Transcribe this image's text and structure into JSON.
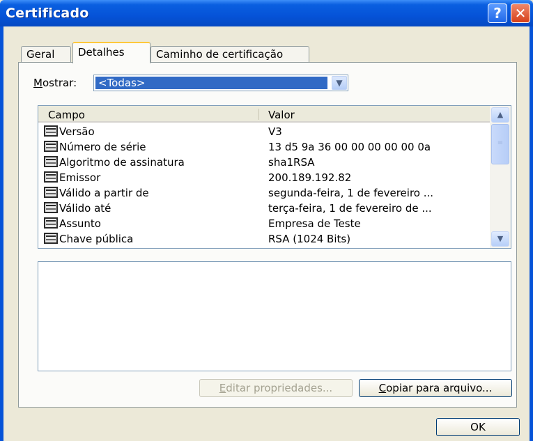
{
  "window": {
    "title": "Certificado",
    "help_glyph": "?",
    "close_glyph": "✕"
  },
  "tabs": [
    {
      "label": "Geral",
      "active": false
    },
    {
      "label": "Detalhes",
      "active": true
    },
    {
      "label": "Caminho de certificação",
      "active": false
    }
  ],
  "show": {
    "label": "Mostrar:",
    "label_underline_char": "M",
    "label_rest": "ostrar:",
    "selected": "<Todas>"
  },
  "list": {
    "headers": {
      "field": "Campo",
      "value": "Valor"
    },
    "rows": [
      {
        "field": "Versão",
        "value": "V3"
      },
      {
        "field": "Número de série",
        "value": "13 d5 9a 36 00 00 00 00 00 0a"
      },
      {
        "field": "Algoritmo de assinatura",
        "value": "sha1RSA"
      },
      {
        "field": "Emissor",
        "value": "200.189.192.82"
      },
      {
        "field": "Válido a partir de",
        "value": "segunda-feira, 1 de fevereiro ..."
      },
      {
        "field": "Válido até",
        "value": "terça-feira, 1 de fevereiro de ..."
      },
      {
        "field": "Assunto",
        "value": "Empresa de Teste"
      },
      {
        "field": "Chave pública",
        "value": "RSA (1024 Bits)"
      }
    ]
  },
  "buttons": {
    "edit": {
      "label": "Editar propriedades...",
      "u": "E",
      "rest": "ditar propriedades...",
      "enabled": false
    },
    "copy": {
      "label": "Copiar para arquivo...",
      "u": "C",
      "rest": "opiar para arquivo...",
      "enabled": true
    },
    "ok": {
      "label": "OK"
    }
  },
  "colors": {
    "titlebar": "#0553d8",
    "selection": "#316ac5",
    "dialog_bg": "#ece9d8",
    "active_tab_accent": "#ffc83c"
  }
}
